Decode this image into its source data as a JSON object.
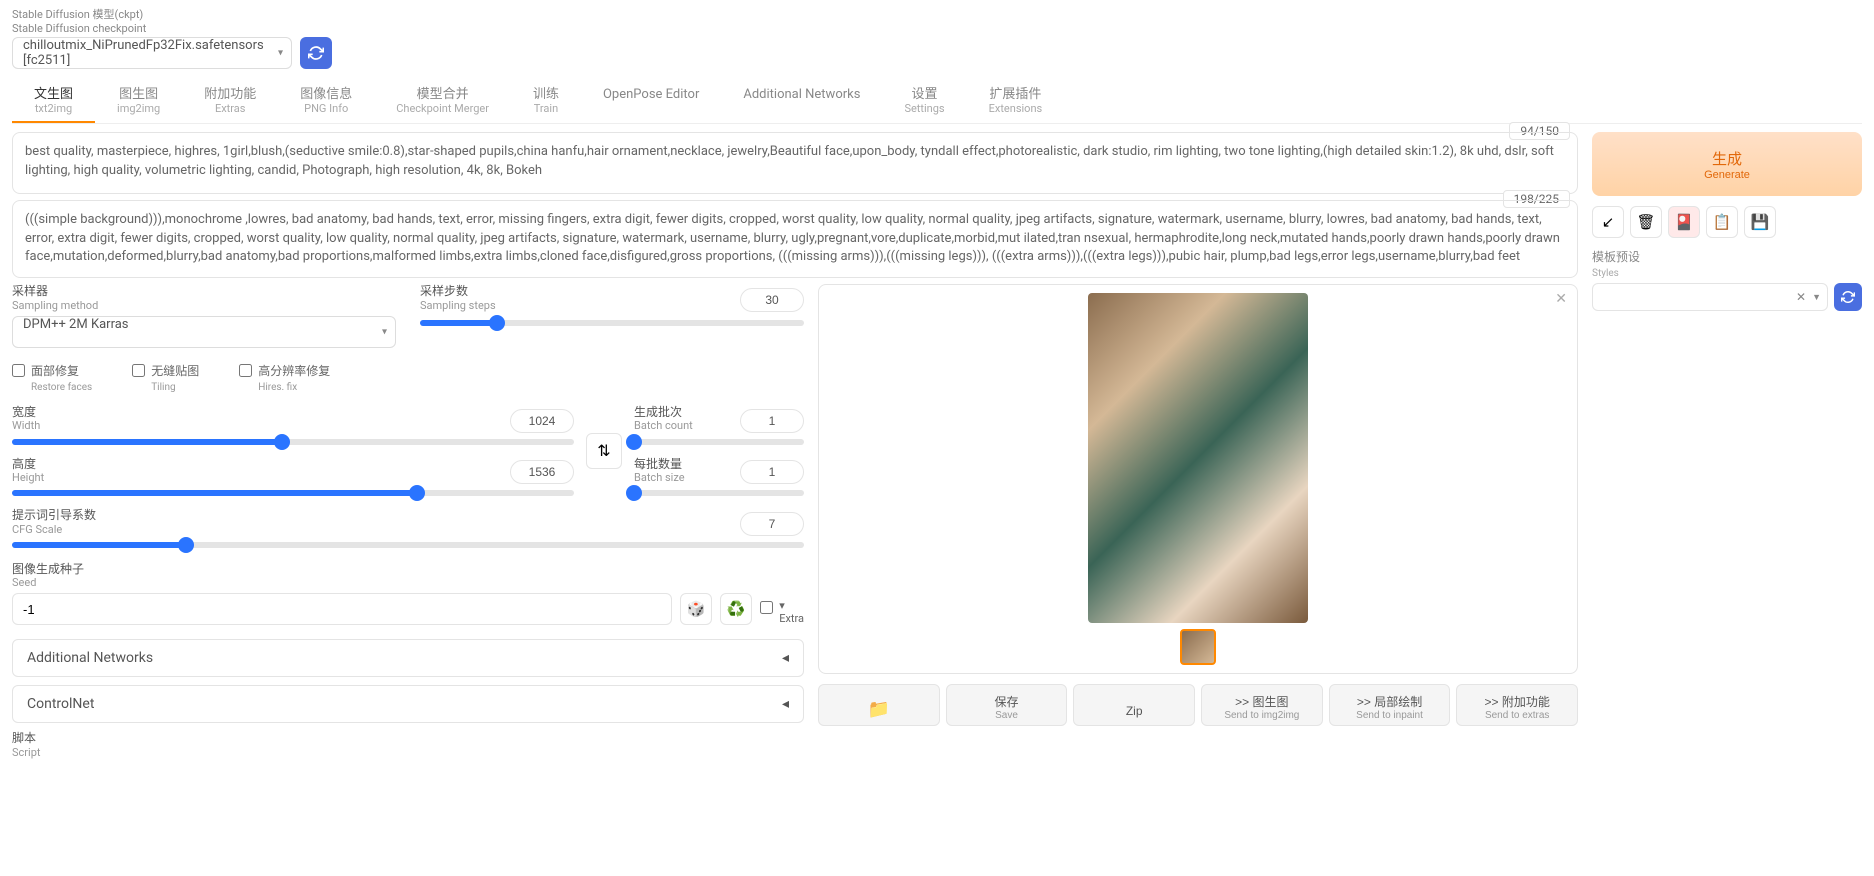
{
  "header": {
    "label_cn": "Stable Diffusion 模型(ckpt)",
    "label_en": "Stable Diffusion checkpoint",
    "checkpoint": "chilloutmix_NiPrunedFp32Fix.safetensors [fc2511]"
  },
  "tabs": [
    {
      "cn": "文生图",
      "en": "txt2img",
      "active": true
    },
    {
      "cn": "图生图",
      "en": "img2img"
    },
    {
      "cn": "附加功能",
      "en": "Extras"
    },
    {
      "cn": "图像信息",
      "en": "PNG Info"
    },
    {
      "cn": "模型合并",
      "en": "Checkpoint Merger"
    },
    {
      "cn": "训练",
      "en": "Train"
    },
    {
      "cn": "OpenPose Editor",
      "en": ""
    },
    {
      "cn": "Additional Networks",
      "en": ""
    },
    {
      "cn": "设置",
      "en": "Settings"
    },
    {
      "cn": "扩展插件",
      "en": "Extensions"
    }
  ],
  "prompt": {
    "text": "best quality, masterpiece, highres, 1girl,blush,(seductive smile:0.8),star-shaped pupils,china hanfu,hair ornament,necklace, jewelry,Beautiful face,upon_body, tyndall effect,photorealistic, dark studio, rim lighting, two tone lighting,(high detailed skin:1.2), 8k uhd, dslr, soft lighting, high quality, volumetric lighting, candid, Photograph, high resolution, 4k, 8k, Bokeh",
    "counter": "94/150"
  },
  "neg_prompt": {
    "text": "(((simple background))),monochrome ,lowres, bad anatomy, bad hands, text, error, missing fingers, extra digit, fewer digits, cropped, worst quality, low quality, normal quality, jpeg artifacts, signature, watermark, username, blurry, lowres, bad anatomy, bad hands, text, error, extra digit, fewer digits, cropped, worst quality, low quality, normal quality, jpeg artifacts, signature, watermark, username, blurry, ugly,pregnant,vore,duplicate,morbid,mut ilated,tran nsexual, hermaphrodite,long neck,mutated hands,poorly drawn hands,poorly drawn face,mutation,deformed,blurry,bad anatomy,bad proportions,malformed limbs,extra limbs,cloned face,disfigured,gross proportions, (((missing arms))),(((missing legs))), (((extra arms))),(((extra legs))),pubic hair, plump,bad legs,error legs,username,blurry,bad feet",
    "counter": "198/225"
  },
  "generate": {
    "cn": "生成",
    "en": "Generate"
  },
  "styles": {
    "label_cn": "模板预设",
    "label_en": "Styles"
  },
  "sampling": {
    "method_cn": "采样器",
    "method_en": "Sampling method",
    "method_value": "DPM++ 2M Karras",
    "steps_cn": "采样步数",
    "steps_en": "Sampling steps",
    "steps_value": "30"
  },
  "checks": {
    "restore_cn": "面部修复",
    "restore_en": "Restore faces",
    "tiling_cn": "无缝贴图",
    "tiling_en": "Tiling",
    "hires_cn": "高分辨率修复",
    "hires_en": "Hires. fix"
  },
  "width": {
    "cn": "宽度",
    "en": "Width",
    "value": "1024"
  },
  "height": {
    "cn": "高度",
    "en": "Height",
    "value": "1536"
  },
  "batch_count": {
    "cn": "生成批次",
    "en": "Batch count",
    "value": "1"
  },
  "batch_size": {
    "cn": "每批数量",
    "en": "Batch size",
    "value": "1"
  },
  "cfg": {
    "cn": "提示词引导系数",
    "en": "CFG Scale",
    "value": "7"
  },
  "seed": {
    "cn": "图像生成种子",
    "en": "Seed",
    "value": "-1",
    "extra": "Extra"
  },
  "accordions": {
    "an": "Additional Networks",
    "cn": "ControlNet"
  },
  "script": {
    "cn": "脚本",
    "en": "Script"
  },
  "actions": {
    "folder": "📁",
    "save_cn": "保存",
    "save_en": "Save",
    "zip": "Zip",
    "img2img_cn": ">> 图生图",
    "img2img_en": "Send to img2img",
    "inpaint_cn": ">> 局部绘制",
    "inpaint_en": "Send to inpaint",
    "extras_cn": ">> 附加功能",
    "extras_en": "Send to extras"
  }
}
